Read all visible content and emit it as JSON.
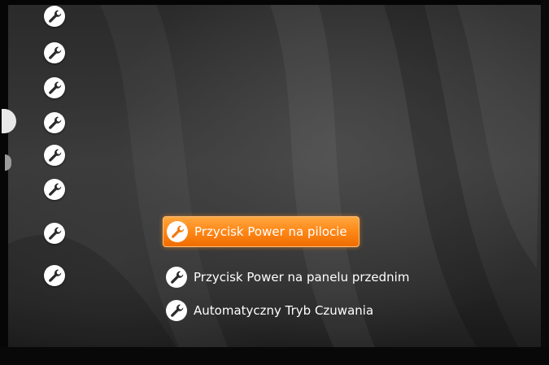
{
  "left_icons": [
    {
      "icon": "wrench-icon"
    },
    {
      "icon": "wrench-icon"
    },
    {
      "icon": "wrench-icon"
    },
    {
      "icon": "wrench-icon"
    },
    {
      "icon": "wrench-icon"
    },
    {
      "icon": "wrench-icon"
    },
    {
      "icon": "wrench-icon"
    },
    {
      "icon": "wrench-icon"
    }
  ],
  "menu": {
    "items": [
      {
        "label": "Przycisk Power na pilocie",
        "icon": "wrench-icon",
        "selected": true
      },
      {
        "label": "Przycisk Power na panelu przednim",
        "icon": "wrench-icon",
        "selected": false
      },
      {
        "label": "Automatyczny Tryb Czuwania",
        "icon": "wrench-icon",
        "selected": false
      }
    ]
  },
  "colors": {
    "accent": "#ff8a1a",
    "background": "#2f2f2f",
    "text": "#ffffff"
  }
}
